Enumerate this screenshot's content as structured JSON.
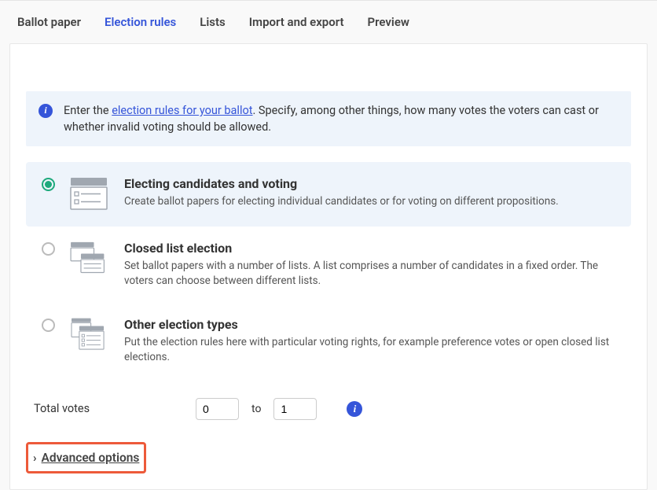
{
  "tabs": {
    "ballot_paper": "Ballot paper",
    "election_rules": "Election rules",
    "lists": "Lists",
    "import_export": "Import and export",
    "preview": "Preview",
    "active": "election_rules"
  },
  "info": {
    "prefix": "Enter the ",
    "link": "election rules for your ballot",
    "suffix": ". Specify, among other things, how many votes the voters can cast or whether invalid voting should be allowed."
  },
  "options": [
    {
      "title": "Electing candidates and voting",
      "desc": "Create ballot papers for electing individual candidates or for voting on different propositions.",
      "selected": true
    },
    {
      "title": "Closed list election",
      "desc": "Set ballot papers with a number of lists. A list comprises a number of candidates in a fixed order. The voters can choose between different lists.",
      "selected": false
    },
    {
      "title": "Other election types",
      "desc": "Put the election rules here with particular voting rights, for example preference votes or open closed list elections.",
      "selected": false
    }
  ],
  "votes": {
    "label": "Total votes",
    "from": "0",
    "to_label": "to",
    "to": "1"
  },
  "advanced": {
    "label": "Advanced options"
  }
}
